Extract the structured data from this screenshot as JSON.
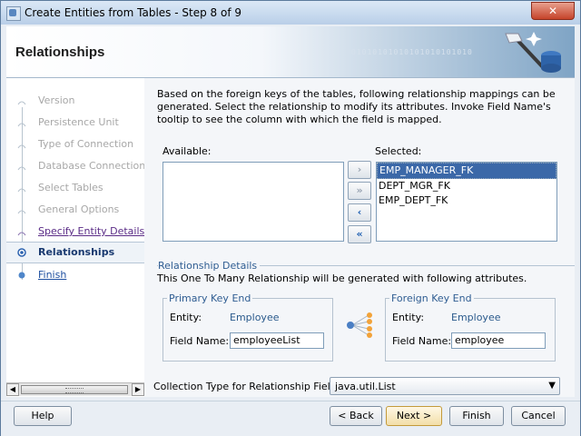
{
  "window": {
    "title": "Create Entities from Tables - Step 8 of 9",
    "close_label": "✕"
  },
  "header": {
    "title": "Relationships",
    "binary_text": "01010101010101010101010"
  },
  "nav": {
    "items": [
      {
        "label": "Version",
        "state": "disabled"
      },
      {
        "label": "Persistence Unit",
        "state": "disabled"
      },
      {
        "label": "Type of Connection",
        "state": "disabled"
      },
      {
        "label": "Database Connection De",
        "state": "disabled"
      },
      {
        "label": "Select Tables",
        "state": "disabled"
      },
      {
        "label": "General Options",
        "state": "disabled"
      },
      {
        "label": "Specify Entity Details",
        "state": "done"
      },
      {
        "label": "Relationships",
        "state": "active"
      },
      {
        "label": "Finish",
        "state": "next"
      }
    ]
  },
  "main": {
    "intro": "Based on the foreign keys of the tables, following relationship mappings can be generated. Select the relationship to modify its attributes. Invoke Field Name's tooltip to see the column with which the field is mapped.",
    "available_label": "Available:",
    "selected_label": "Selected:",
    "selected_items": [
      "EMP_MANAGER_FK",
      "DEPT_MGR_FK",
      "EMP_DEPT_FK"
    ],
    "move_buttons": {
      "add": "›",
      "add_all": "»",
      "remove": "‹",
      "remove_all": "«"
    },
    "details_title": "Relationship Details",
    "details_desc": "This One To Many Relationship will be generated with following attributes.",
    "primary": {
      "title": "Primary Key End",
      "entity_label": "Entity:",
      "entity_value": "Employee",
      "field_label": "Field Name:",
      "field_value": "employeeList"
    },
    "foreign": {
      "title": "Foreign Key End",
      "entity_label": "Entity:",
      "entity_value": "Employee",
      "field_label": "Field Name:",
      "field_value": "employee"
    },
    "collection_label": "Collection Type for Relationship Fields:",
    "collection_value": "java.util.List"
  },
  "footer": {
    "help": "Help",
    "back": "< Back",
    "next": "Next >",
    "finish": "Finish",
    "cancel": "Cancel"
  }
}
